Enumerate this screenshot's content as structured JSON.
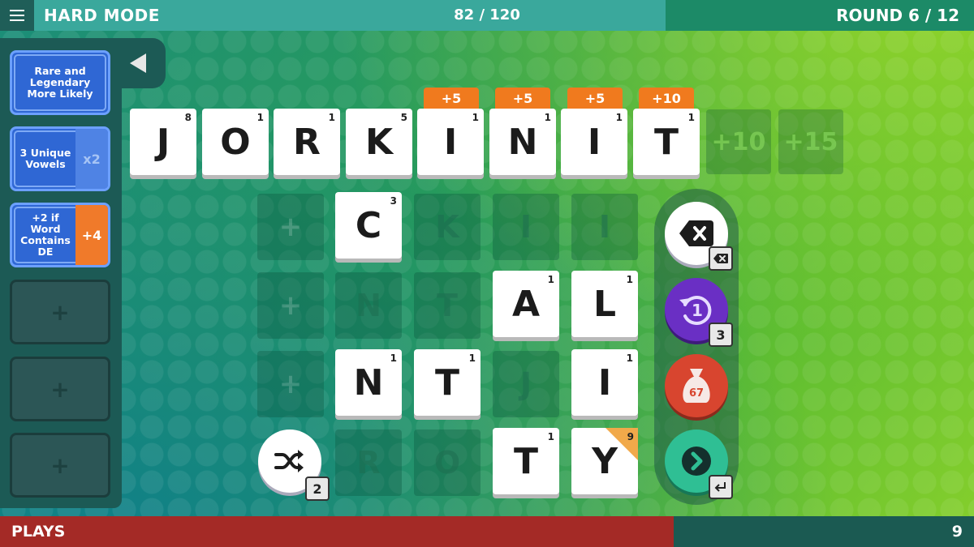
{
  "topbar": {
    "mode": "HARD MODE",
    "score": "82 / 120",
    "round": "ROUND 6 / 12"
  },
  "bottombar": {
    "plays_label": "PLAYS",
    "plays_count": "9"
  },
  "cards": [
    {
      "text": "Rare and Legendary More Likely",
      "mult": ""
    },
    {
      "text": "3 Unique Vowels",
      "mult": "x2"
    },
    {
      "text": "+2 if Word Contains DE",
      "mult": "+4"
    },
    {
      "plus": "+"
    },
    {
      "plus": "+"
    },
    {
      "plus": "+"
    }
  ],
  "word": {
    "letters": [
      {
        "letter": "J",
        "value": "8"
      },
      {
        "letter": "O",
        "value": "1"
      },
      {
        "letter": "R",
        "value": "1"
      },
      {
        "letter": "K",
        "value": "5"
      },
      {
        "letter": "I",
        "value": "1"
      },
      {
        "letter": "N",
        "value": "1"
      },
      {
        "letter": "I",
        "value": "1"
      },
      {
        "letter": "T",
        "value": "1"
      }
    ],
    "bonuses": [
      "+5",
      "+5",
      "+5",
      "+10"
    ],
    "extra_slots": [
      "+10",
      "+15"
    ]
  },
  "grid": {
    "row1": {
      "plus": "+",
      "c1": {
        "letter": "C",
        "value": "3"
      },
      "g2": "K",
      "g3": "I",
      "g4": "I"
    },
    "row2": {
      "plus": "+",
      "g1": "N",
      "g2": "T",
      "c3": {
        "letter": "A",
        "value": "1"
      },
      "c4": {
        "letter": "L",
        "value": "1"
      }
    },
    "row3": {
      "plus": "+",
      "c1": {
        "letter": "N",
        "value": "1"
      },
      "c2": {
        "letter": "T",
        "value": "1"
      },
      "g3": "J",
      "c4": {
        "letter": "I",
        "value": "1"
      }
    },
    "row4": {
      "g1": "R",
      "g2": "O",
      "c3": {
        "letter": "T",
        "value": "1"
      },
      "c4": {
        "letter": "Y",
        "value": "9"
      }
    }
  },
  "controls": {
    "shuffle_count": "2",
    "undo_count": "3",
    "undo_number": "1",
    "bag_count": "67"
  },
  "colors": {
    "bonus_orange": "#f07a1e",
    "rare_corner": "#f1a94a",
    "plays_red": "#a42a26",
    "undo_purple": "#6a2fc4",
    "bag_red": "#d8452f",
    "submit_green": "#2fbf94"
  }
}
